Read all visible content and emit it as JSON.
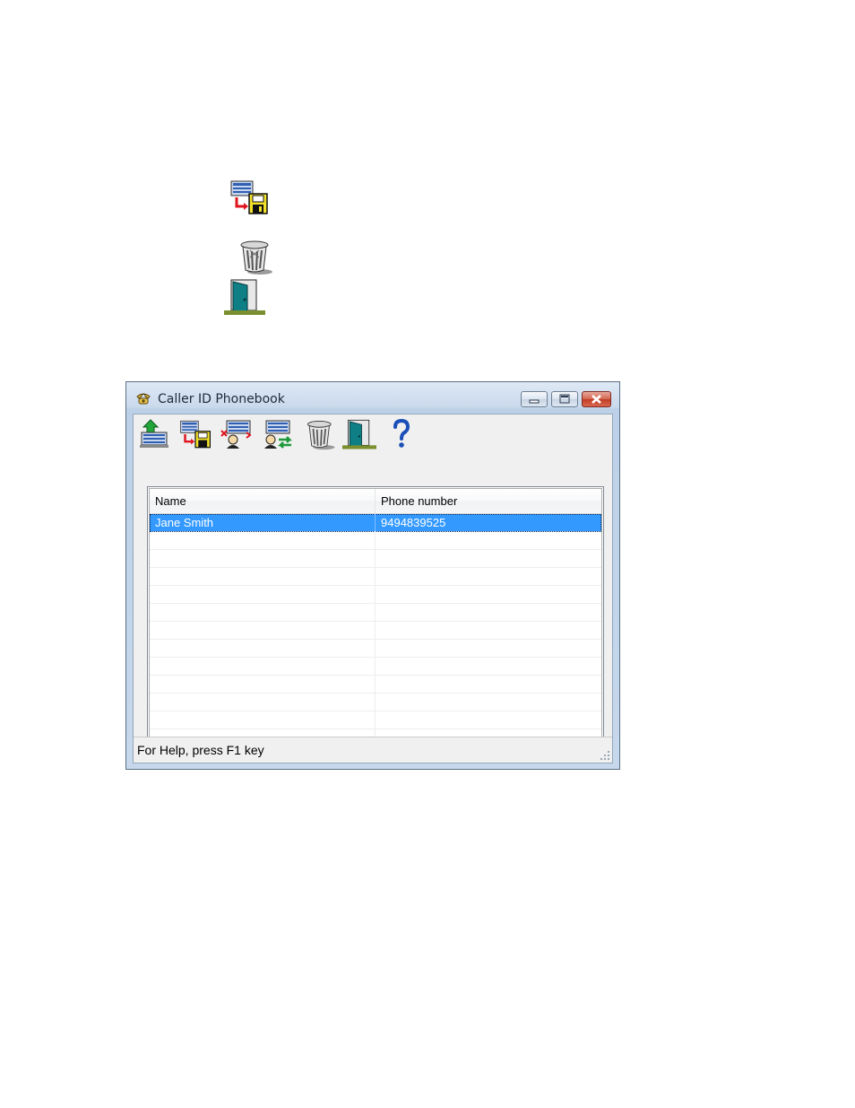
{
  "doc_icons": [
    {
      "name": "save-to-disk-icon"
    },
    {
      "name": "trash-icon"
    },
    {
      "name": "exit-door-icon"
    }
  ],
  "window": {
    "title": "Caller ID Phonebook",
    "title_icon": "telephone-icon",
    "controls": [
      "minimize-icon",
      "maximize-icon",
      "close-icon"
    ]
  },
  "toolbar": {
    "buttons": [
      {
        "name": "import-button",
        "icon": "upload-arrow-icon"
      },
      {
        "name": "save-button",
        "icon": "save-to-disk-icon"
      },
      {
        "name": "delete-entry-button",
        "icon": "delete-person-icon"
      },
      {
        "name": "transfer-button",
        "icon": "transfer-arrows-icon"
      },
      {
        "name": "trash-button",
        "icon": "trash-icon"
      },
      {
        "name": "exit-button",
        "icon": "exit-door-icon"
      },
      {
        "name": "help-button",
        "icon": "question-mark-icon"
      }
    ]
  },
  "list": {
    "columns": [
      "Name",
      "Phone number"
    ],
    "rows": [
      {
        "name": "Jane Smith",
        "phone": "9494839525",
        "selected": true
      }
    ],
    "empty_rows": 12
  },
  "status": {
    "text": "For Help, press F1 key"
  }
}
